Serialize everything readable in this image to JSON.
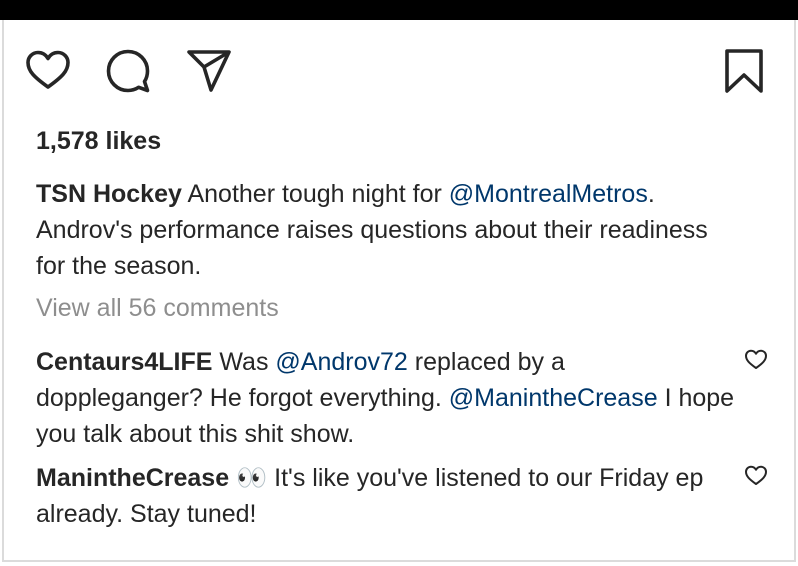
{
  "post": {
    "likes": "1,578 likes",
    "caption": {
      "username": "TSN Hockey",
      "text_before": "Another tough night for",
      "mention": "@MontrealMetros",
      "text_after": ". Androv's performance raises questions about their readiness for the season."
    },
    "view_all_comments": "View all 56 comments"
  },
  "comments": [
    {
      "username": "Centaurs4LIFE",
      "text_1": "Was",
      "mention_1": "@Androv72",
      "text_2": "replaced by a doppleganger? He forgot everything.",
      "mention_2": "@ManintheCrease",
      "text_3": "I hope you talk about this shit show."
    },
    {
      "username": "ManintheCrease",
      "text": "👀 It's like you've listened to our Friday ep already. Stay tuned!"
    }
  ],
  "icons": {
    "like": "heart-icon",
    "comment": "comment-bubble-icon",
    "share": "paper-plane-icon",
    "save": "bookmark-icon",
    "comment_like": "heart-icon"
  },
  "colors": {
    "text": "#262626",
    "mention": "#00376b",
    "muted": "#8e8e8e",
    "border": "#dbdbdb",
    "top_bar": "#000000"
  }
}
